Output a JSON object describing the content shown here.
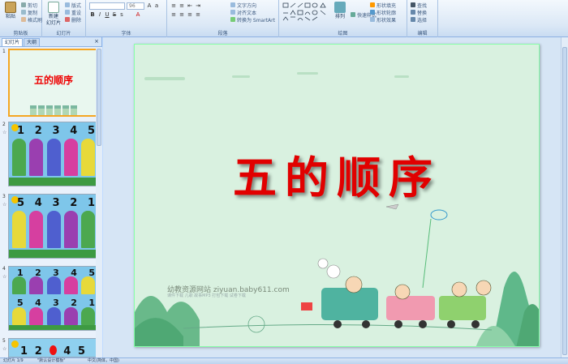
{
  "ribbon": {
    "clipboard": {
      "paste": "粘贴",
      "cut": "剪切",
      "copy": "复制",
      "format_painter": "格式刷",
      "label": "剪贴板"
    },
    "slides": {
      "new_slide_line1": "新建",
      "new_slide_line2": "幻灯片",
      "layout": "版式",
      "reset": "重设",
      "delete": "删除",
      "label": "幻灯片"
    },
    "font": {
      "size_value": "96",
      "label": "字体"
    },
    "paragraph": {
      "text_direction": "文字方向",
      "align_text": "对齐文本",
      "smartart": "转换为 SmartArt",
      "label": "段落"
    },
    "drawing": {
      "arrange": "排列",
      "quick_styles": "快速样式",
      "shape_fill": "形状填充",
      "shape_outline": "形状轮廓",
      "shape_effects": "形状效果",
      "label": "绘图"
    },
    "editing": {
      "find": "查找",
      "replace": "替换",
      "select": "选择",
      "label": "编辑"
    }
  },
  "left_panel": {
    "tabs": [
      "幻灯片",
      "大纲"
    ],
    "close_glyph": "×",
    "thumbnails": [
      {
        "num": "1",
        "title": "五的顺序"
      },
      {
        "num": "2",
        "numbers": [
          "1",
          "2",
          "3",
          "4",
          "5"
        ]
      },
      {
        "num": "3",
        "numbers": [
          "5",
          "4",
          "3",
          "2",
          "1"
        ]
      },
      {
        "num": "4",
        "numbers_top": [
          "1",
          "2",
          "3",
          "4",
          "5"
        ],
        "numbers_bottom": [
          "5",
          "4",
          "3",
          "2",
          "1"
        ]
      },
      {
        "num": "5",
        "numbers": [
          "1",
          "2",
          "4",
          "5"
        ]
      }
    ]
  },
  "slide": {
    "title": "五的顺序",
    "watermark_line1": "幼教资源网站  ziyuan.baby611.com",
    "watermark_line2": "课件下载  儿歌  故事MP3  打包下载  试卷下载"
  },
  "statusbar": {
    "slide_info": "幻灯片 1/9",
    "theme": "\"默认设计模板\"",
    "language": "中文(简体，中国)"
  },
  "colors": {
    "title_red": "#e10000",
    "slide_bg": "#d9f1e0",
    "ribbon_blue": "#dbe8f6"
  },
  "house_colors": [
    "#4ca84f",
    "#9a3fb0",
    "#4f5fcf",
    "#d63fa0",
    "#e7d93a"
  ]
}
